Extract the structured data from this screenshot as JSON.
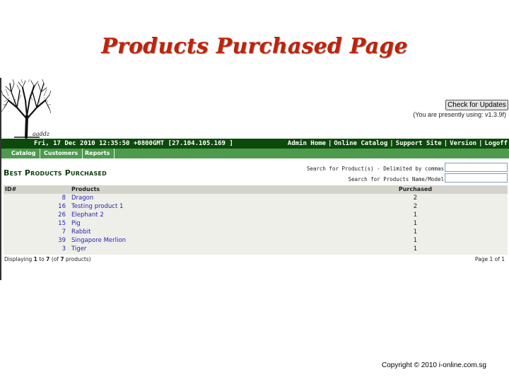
{
  "slide": {
    "title": "Products Purchased Page",
    "copyright": "Copyright © 2010 i-online.com.sg"
  },
  "admin": {
    "logo_text": "aaddz",
    "update_button": "Check for Updates",
    "version_note": "(You are presently using: v1.3.9f)",
    "datetime": "Fri, 17 Dec 2010 12:35:50 +0800GMT [27.104.105.169 ]",
    "header_links": [
      "Admin Home",
      "Online Catalog",
      "Support Site",
      "Version",
      "Logoff"
    ],
    "nav_tabs": [
      "Catalog",
      "Customers",
      "Reports"
    ],
    "section_title": "Best Products Purchased",
    "search_label_1": "Search for Product(s) - Delimited by commas",
    "search_label_2": "Search for Products Name/Model",
    "search_value_1": "",
    "search_value_2": "",
    "table": {
      "headers": {
        "id": "ID#",
        "products": "Products",
        "purchased": "Purchased"
      },
      "rows": [
        {
          "id": "8",
          "name": "Dragon",
          "purchased": "2"
        },
        {
          "id": "16",
          "name": "Testing product 1",
          "purchased": "2"
        },
        {
          "id": "26",
          "name": "Elephant 2",
          "purchased": "1"
        },
        {
          "id": "15",
          "name": "Pig",
          "purchased": "1"
        },
        {
          "id": "7",
          "name": "Rabbit",
          "purchased": "1"
        },
        {
          "id": "39",
          "name": "Singapore Merlion",
          "purchased": "1"
        },
        {
          "id": "3",
          "name": "Tiger",
          "purchased": "1"
        }
      ]
    },
    "display_count": {
      "prefix": "Displaying ",
      "from": "1",
      "to_word": " to ",
      "to": "7",
      "of_word": " (of ",
      "total": "7",
      "suffix": " products)"
    },
    "page_info": "Page 1 of 1"
  }
}
